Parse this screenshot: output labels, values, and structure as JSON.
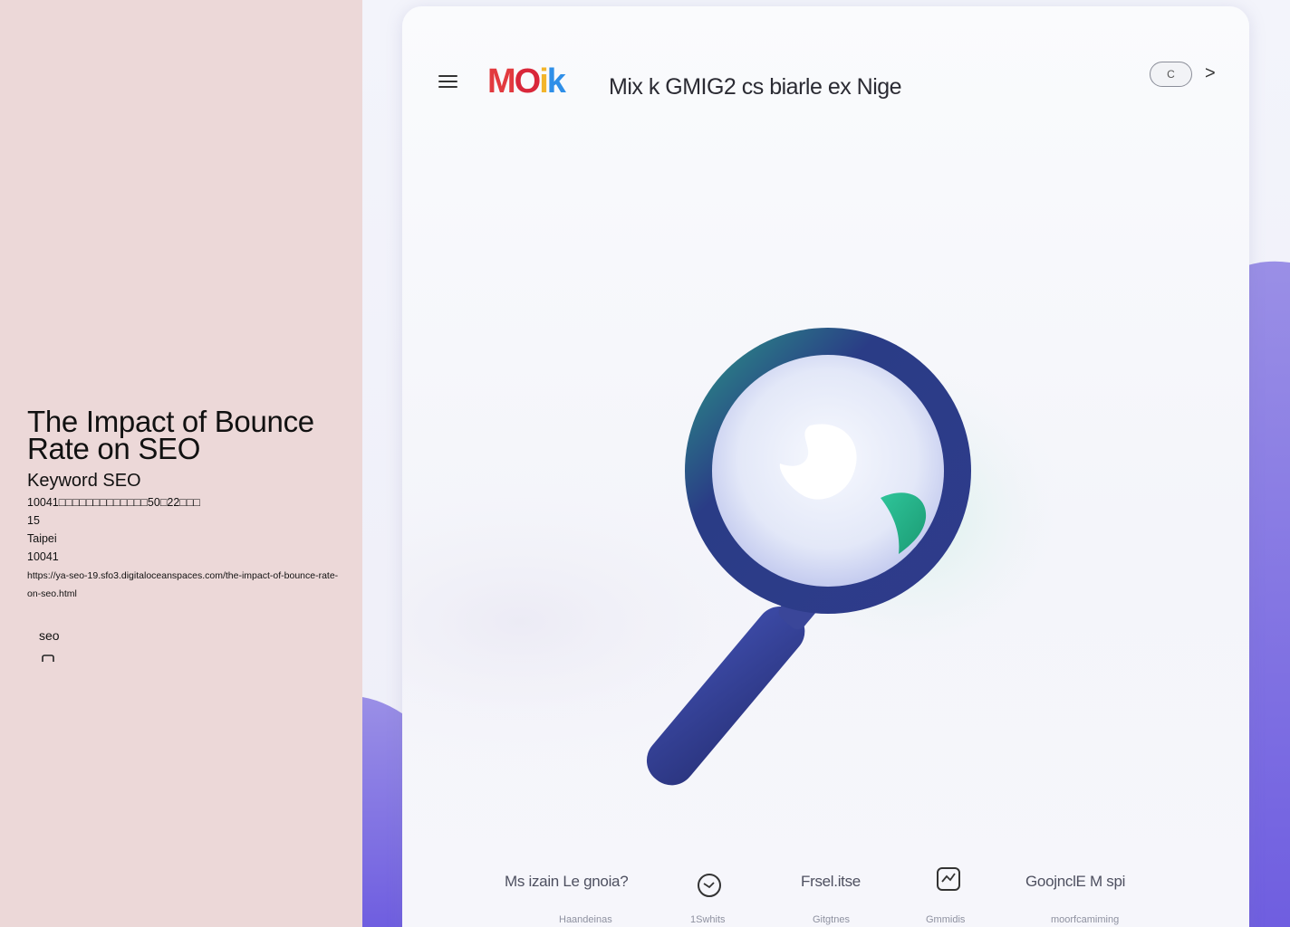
{
  "left_panel": {
    "title": "The Impact of Bounce Rate on SEO",
    "subtitle": "Keyword SEO",
    "address_line1": "10041□□□□□□□□□□□□□50□22□□□",
    "address_line2": "15",
    "city": "Taipei",
    "postal_code": "10041",
    "url": "https://ya-seo-19.sfo3.digitaloceanspaces.com/the-impact-of-bounce-rate-on-seo.html",
    "tag": "seo"
  },
  "hero": {
    "logo_parts": [
      "M",
      "O",
      "i",
      "k"
    ],
    "header_title": "Mix k  GMIG2 cs biarle  ex  Nige",
    "toggle_label": "C",
    "next_glyph": ">",
    "footer_items": [
      {
        "label": "Ms izain Le gnoia?",
        "sub": "Haandeinas"
      },
      {
        "label": "",
        "sub": "1Swhits",
        "icon": "gauge-icon"
      },
      {
        "label": "Frsel.itse",
        "sub": "Gitgtnes"
      },
      {
        "label": "",
        "sub": "Gmmidis",
        "icon": "chart-card-icon"
      },
      {
        "label": "GoojnclE M spi",
        "sub": "moorfcamiming"
      }
    ]
  }
}
